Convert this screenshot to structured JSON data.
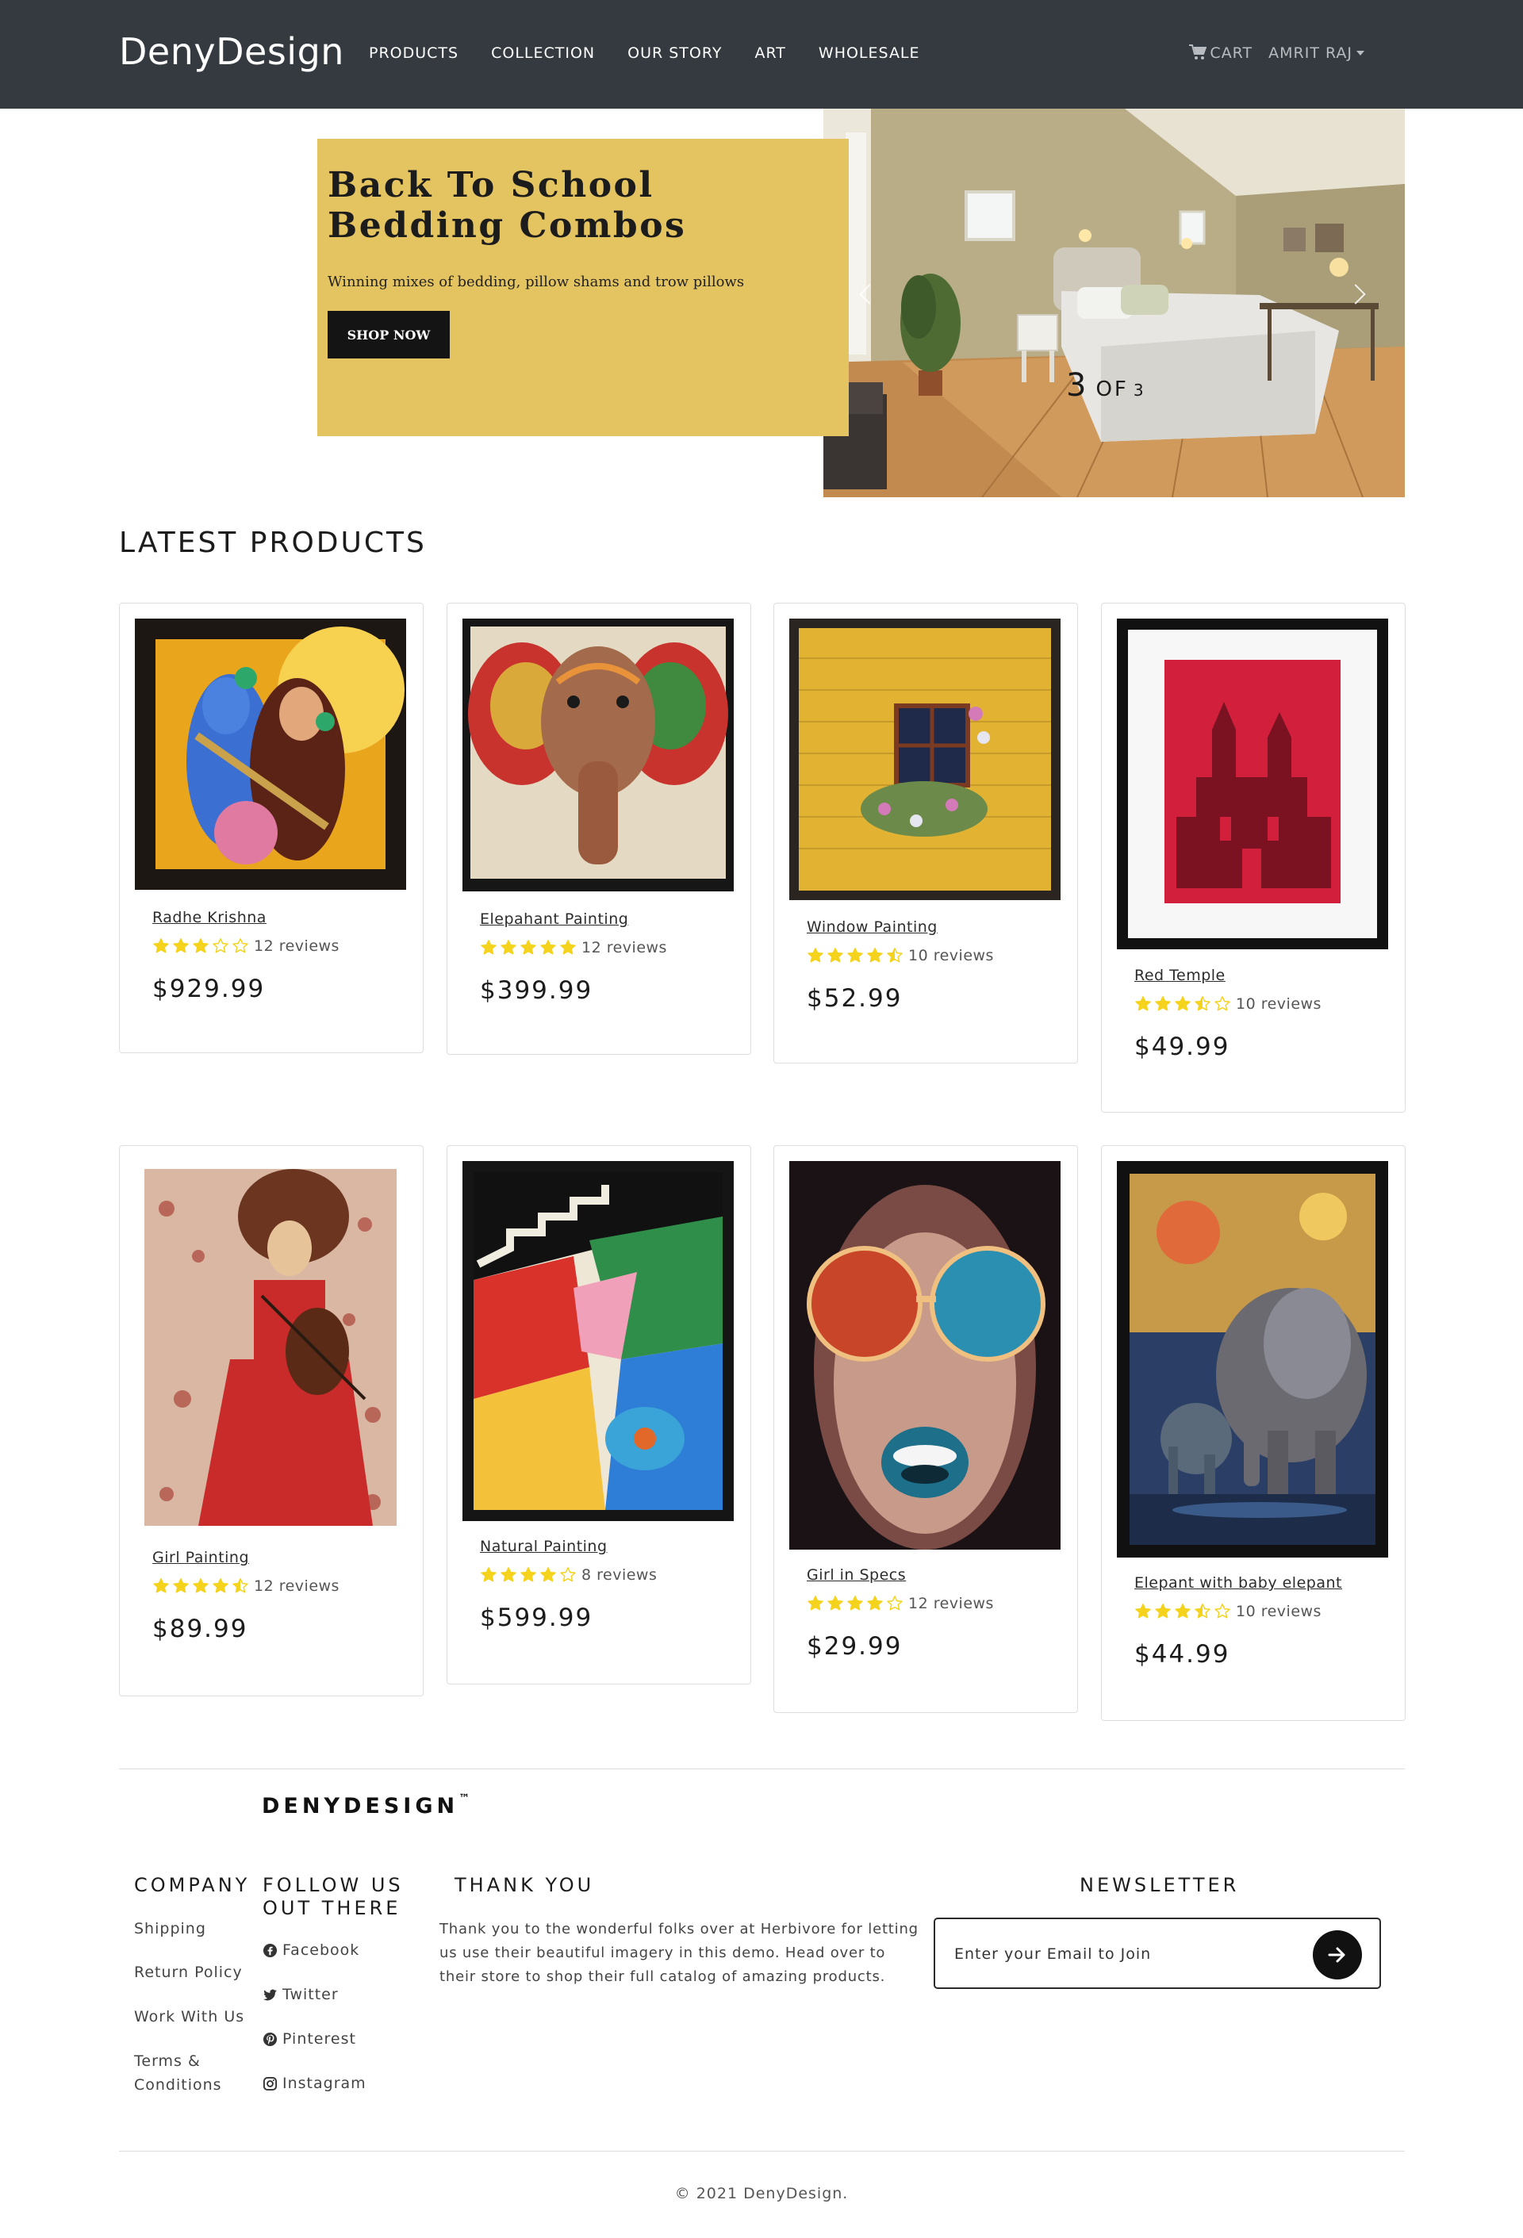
{
  "navbar": {
    "brand": "DenyDesign",
    "links": [
      "PRODUCTS",
      "COLLECTION",
      "OUR STORY",
      "ART",
      "WHOLESALE"
    ],
    "cart_label": "CART",
    "user_label": "AMRIT RAJ"
  },
  "hero": {
    "title": "Back To School Bedding Combos",
    "subtitle": "Winning mixes of bedding, pillow shams and trow pillows",
    "button_label": "SHOP NOW",
    "slide_current": "3",
    "slide_of": "OF",
    "slide_total": "3",
    "card_color": "#e4c460"
  },
  "section_title": "LATEST PRODUCTS",
  "products": [
    {
      "name": "Radhe Krishna",
      "rating": 3,
      "reviews": "12 reviews",
      "price": "$929.99"
    },
    {
      "name": "Elepahant Painting",
      "rating": 5,
      "reviews": "12 reviews",
      "price": "$399.99"
    },
    {
      "name": "Window Painting",
      "rating": 4.5,
      "reviews": "10 reviews",
      "price": "$52.99"
    },
    {
      "name": "Red Temple",
      "rating": 3.5,
      "reviews": "10 reviews",
      "price": "$49.99"
    },
    {
      "name": "Girl Painting",
      "rating": 4.5,
      "reviews": "12 reviews",
      "price": "$89.99"
    },
    {
      "name": "Natural Painting",
      "rating": 4,
      "reviews": "8 reviews",
      "price": "$599.99"
    },
    {
      "name": "Girl in Specs",
      "rating": 4,
      "reviews": "12 reviews",
      "price": "$29.99"
    },
    {
      "name": "Elepant with baby elepant",
      "rating": 3.5,
      "reviews": "10 reviews",
      "price": "$44.99"
    }
  ],
  "footer": {
    "brand": "DENYDESIGN",
    "trademark": "™",
    "company_heading": "COMPANY",
    "company_links": [
      "Shipping",
      "Return Policy",
      "Work With Us",
      "Terms & Conditions"
    ],
    "follow_heading": "FOLLOW US OUT THERE",
    "social_links": [
      {
        "label": "Facebook",
        "icon": "facebook-icon"
      },
      {
        "label": "Twitter",
        "icon": "twitter-icon"
      },
      {
        "label": "Pinterest",
        "icon": "pinterest-icon"
      },
      {
        "label": "Instagram",
        "icon": "instagram-icon"
      }
    ],
    "thanks_heading": "THANK YOU",
    "thanks_text": "Thank you to the wonderful folks over at Herbivore for letting us use their beautiful imagery in this demo. Head over to their store to shop their full catalog of amazing products.",
    "newsletter_heading": "NEWSLETTER",
    "newsletter_placeholder": "Enter your Email to Join",
    "copyright": "© 2021 DenyDesign.",
    "star_color": "#f5d31c"
  }
}
